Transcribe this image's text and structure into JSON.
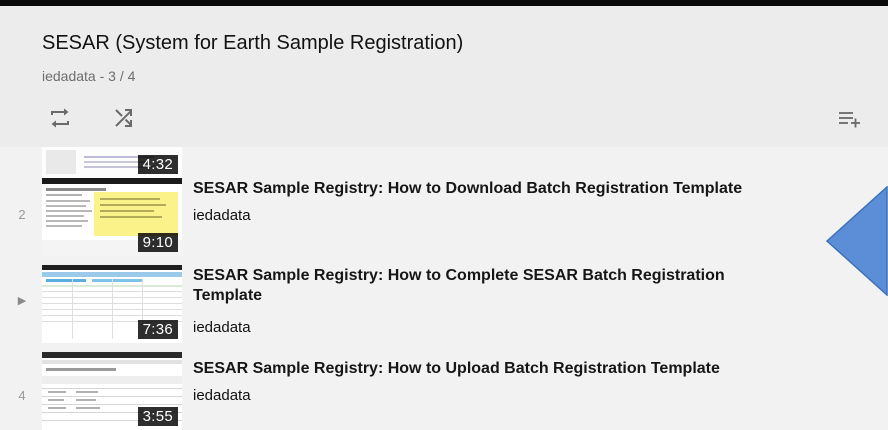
{
  "playlist": {
    "title": "SESAR (System for Earth Sample Registration)",
    "meta": "iedadata - 3 / 4"
  },
  "controls": {
    "loop_icon": "loop-icon",
    "shuffle_icon": "shuffle-icon",
    "save_icon": "add-to-queue-icon"
  },
  "videos": [
    {
      "index": "",
      "duration": "4:32",
      "title": "",
      "channel": ""
    },
    {
      "index": "2",
      "duration": "9:10",
      "title": "SESAR Sample Registry: How to Download Batch Registration Template",
      "channel": "iedadata"
    },
    {
      "index": "▶",
      "duration": "7:36",
      "title": "SESAR Sample Registry: How to Complete SESAR Batch Registration Template",
      "channel": "iedadata"
    },
    {
      "index": "4",
      "duration": "3:55",
      "title": "SESAR Sample Registry: How to Upload Batch Registration Template",
      "channel": "iedadata"
    }
  ],
  "colors": {
    "arrow_fill": "#5b8ed6",
    "arrow_stroke": "#3e70b8"
  }
}
